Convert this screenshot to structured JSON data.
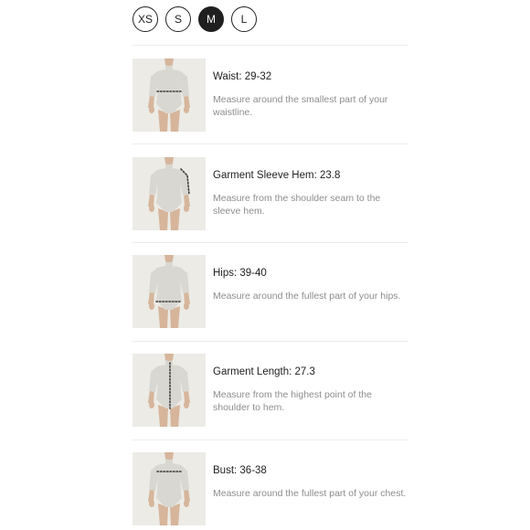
{
  "sizes": [
    {
      "label": "XS",
      "selected": false
    },
    {
      "label": "S",
      "selected": false
    },
    {
      "label": "M",
      "selected": true
    },
    {
      "label": "L",
      "selected": false
    }
  ],
  "measurements": [
    {
      "title": "Waist: 29-32",
      "description": "Measure around the smallest part of your waistline.",
      "indicator": "waist"
    },
    {
      "title": "Garment Sleeve Hem: 23.8",
      "description": "Measure from the shoulder seam to the sleeve hem.",
      "indicator": "sleeve"
    },
    {
      "title": "Hips: 39-40",
      "description": "Measure around the fullest part of your hips.",
      "indicator": "hips"
    },
    {
      "title": "Garment Length: 27.3",
      "description": "Measure from the highest point of the shoulder to hem.",
      "indicator": "length"
    },
    {
      "title": "Bust: 36-38",
      "description": "Measure around the fullest part of your chest.",
      "indicator": "bust"
    }
  ],
  "colors": {
    "selected_bg": "#1f1f1f",
    "divider": "#ececec",
    "description_text": "#8d8d8d",
    "thumbnail_bg": "#ecebe6",
    "bodysuit": "#d9d7d1",
    "skin": "#d6b59b"
  }
}
